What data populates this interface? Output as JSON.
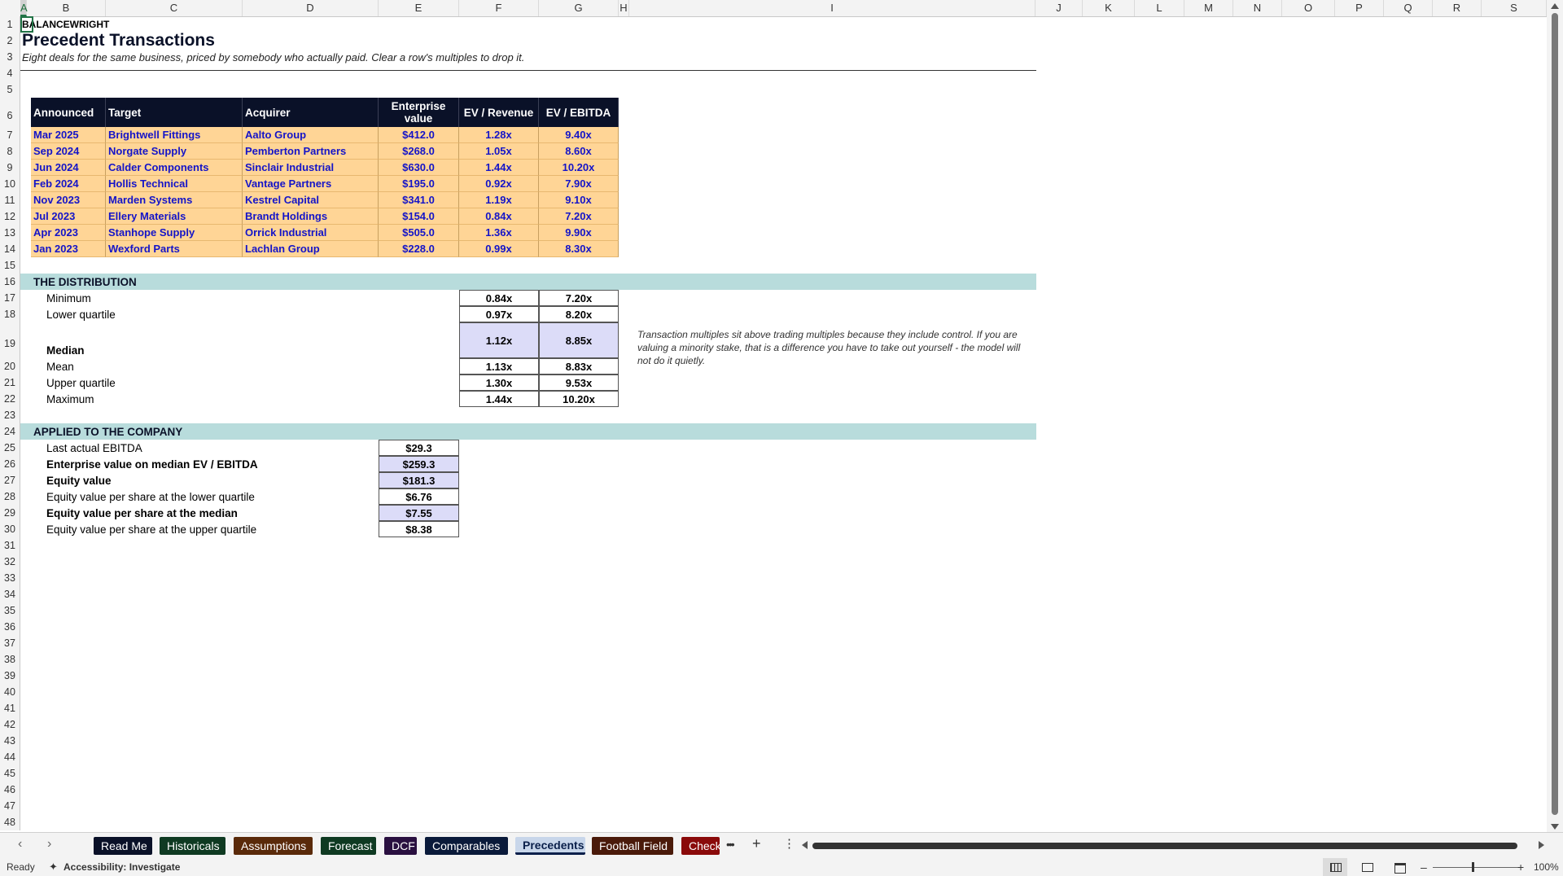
{
  "columns": [
    "A",
    "B",
    "C",
    "D",
    "E",
    "F",
    "G",
    "H",
    "I",
    "J",
    "K",
    "L",
    "M",
    "N",
    "O",
    "P",
    "Q",
    "R",
    "S"
  ],
  "rows": [
    "1",
    "2",
    "3",
    "4",
    "5",
    "6",
    "7",
    "8",
    "9",
    "10",
    "11",
    "12",
    "13",
    "14",
    "15",
    "16",
    "17",
    "18",
    "19",
    "20",
    "21",
    "22",
    "23",
    "24",
    "25",
    "26",
    "27",
    "28",
    "29",
    "30",
    "31",
    "32",
    "33",
    "34",
    "35",
    "36",
    "37",
    "38",
    "39",
    "40",
    "41",
    "42",
    "43",
    "44",
    "45",
    "46",
    "47",
    "48"
  ],
  "brand": "BALANCEWRIGHT",
  "title": "Precedent Transactions",
  "subtitle": "Eight deals for the same business, priced by somebody who actually paid. Clear a row's multiples to drop it.",
  "table": {
    "headers": [
      "Announced",
      "Target",
      "Acquirer",
      "Enterprise value",
      "EV / Revenue",
      "EV / EBITDA"
    ],
    "rows": [
      [
        "Mar 2025",
        "Brightwell Fittings",
        "Aalto Group",
        "$412.0",
        "1.28x",
        "9.40x"
      ],
      [
        "Sep 2024",
        "Norgate Supply",
        "Pemberton Partners",
        "$268.0",
        "1.05x",
        "8.60x"
      ],
      [
        "Jun 2024",
        "Calder Components",
        "Sinclair Industrial",
        "$630.0",
        "1.44x",
        "10.20x"
      ],
      [
        "Feb 2024",
        "Hollis Technical",
        "Vantage Partners",
        "$195.0",
        "0.92x",
        "7.90x"
      ],
      [
        "Nov 2023",
        "Marden Systems",
        "Kestrel Capital",
        "$341.0",
        "1.19x",
        "9.10x"
      ],
      [
        "Jul 2023",
        "Ellery Materials",
        "Brandt Holdings",
        "$154.0",
        "0.84x",
        "7.20x"
      ],
      [
        "Apr 2023",
        "Stanhope Supply",
        "Orrick Industrial",
        "$505.0",
        "1.36x",
        "9.90x"
      ],
      [
        "Jan 2023",
        "Wexford Parts",
        "Lachlan Group",
        "$228.0",
        "0.99x",
        "8.30x"
      ]
    ]
  },
  "distribution": {
    "heading": "THE DISTRIBUTION",
    "rows": [
      {
        "label": "Minimum",
        "rev": "0.84x",
        "ebitda": "7.20x"
      },
      {
        "label": "Lower quartile",
        "rev": "0.97x",
        "ebitda": "8.20x"
      },
      {
        "label": "Median",
        "rev": "1.12x",
        "ebitda": "8.85x"
      },
      {
        "label": "Mean",
        "rev": "1.13x",
        "ebitda": "8.83x"
      },
      {
        "label": "Upper quartile",
        "rev": "1.30x",
        "ebitda": "9.53x"
      },
      {
        "label": "Maximum",
        "rev": "1.44x",
        "ebitda": "10.20x"
      }
    ],
    "note": "Transaction multiples sit above trading multiples because they include control. If you are valuing a minority stake, that is a difference you have to take out yourself - the model will not do it quietly."
  },
  "applied": {
    "heading": "APPLIED TO THE COMPANY",
    "rows": [
      {
        "label": "Last actual EBITDA",
        "value": "$29.3"
      },
      {
        "label": "Enterprise value on median EV / EBITDA",
        "value": "$259.3"
      },
      {
        "label": "Equity value",
        "value": "$181.3"
      },
      {
        "label": "Equity value per share at the lower quartile",
        "value": "$6.76"
      },
      {
        "label": "Equity value per share at the median",
        "value": "$7.55"
      },
      {
        "label": "Equity value per share at the upper quartile",
        "value": "$8.38"
      }
    ]
  },
  "tabs": [
    {
      "label": "Read Me",
      "color": "#0a1128"
    },
    {
      "label": "Historicals",
      "color": "#0f3a22"
    },
    {
      "label": "Assumptions",
      "color": "#5a2a0a"
    },
    {
      "label": "Forecast",
      "color": "#0f3a22"
    },
    {
      "label": "DCF",
      "color": "#2a1040"
    },
    {
      "label": "Comparables",
      "color": "#0a1a3a"
    },
    {
      "label": "Precedents",
      "color": "#c8d6ea"
    },
    {
      "label": "Football Field",
      "color": "#4a1a0a"
    },
    {
      "label": "Checks",
      "color": "#8a0a0a"
    }
  ],
  "status": {
    "ready": "Ready",
    "accessibility": "Accessibility: Investigate",
    "zoom": "100%"
  }
}
